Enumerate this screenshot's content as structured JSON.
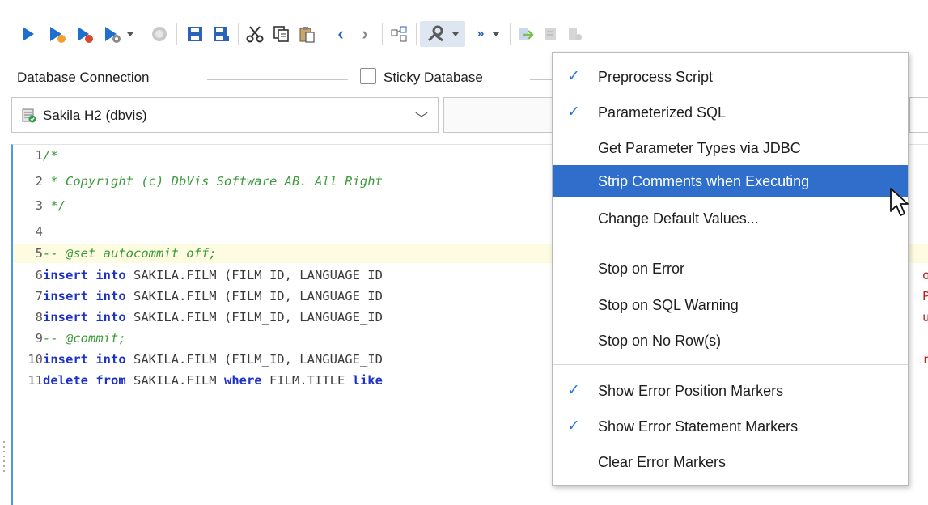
{
  "toolbar": {
    "buttons": [
      {
        "name": "execute-icon"
      },
      {
        "name": "execute-current-icon"
      },
      {
        "name": "execute-buffer-icon"
      },
      {
        "name": "execute-explain-icon"
      },
      {
        "name": "stop-icon"
      },
      {
        "name": "save-icon"
      },
      {
        "name": "save-as-icon"
      },
      {
        "name": "cut-icon"
      },
      {
        "name": "copy-icon"
      },
      {
        "name": "paste-icon"
      },
      {
        "name": "back-icon"
      },
      {
        "name": "forward-icon"
      },
      {
        "name": "query-builder-icon"
      },
      {
        "name": "sql-commander-options-icon"
      },
      {
        "name": "auto-commit-icon"
      },
      {
        "name": "commit-icon"
      },
      {
        "name": "rollback-icon"
      },
      {
        "name": "transaction-icon"
      }
    ]
  },
  "connection": {
    "label": "Database Connection",
    "sticky_label": "Sticky Database",
    "sticky_checked": false,
    "selected": "Sakila H2 (dbvis)"
  },
  "editor": {
    "lines": [
      {
        "no": "1",
        "text": "/*"
      },
      {
        "no": "2",
        "text": " * Copyright (c) DbVis Software AB. All Right"
      },
      {
        "no": "3",
        "text": " */"
      },
      {
        "no": "4",
        "text": ""
      },
      {
        "no": "5",
        "text": "-- @set autocommit off;"
      },
      {
        "no": "6",
        "kw": "insert into",
        "rest": " SAKILA.FILM (FILM_ID, LANGUAGE_ID"
      },
      {
        "no": "7",
        "kw": "insert into",
        "rest": " SAKILA.FILM (FILM_ID, LANGUAGE_ID"
      },
      {
        "no": "8",
        "kw": "insert into",
        "rest": " SAKILA.FILM (FILM_ID, LANGUAGE_ID"
      },
      {
        "no": "9",
        "text": "-- @commit;"
      },
      {
        "no": "10",
        "kw": "insert into",
        "rest": " SAKILA.FILM (FILM_ID, LANGUAGE_ID"
      },
      {
        "no": "11",
        "kw": "delete from",
        "rest": " SAKILA.FILM ",
        "kw2": "where",
        "rest2": " FILM.TITLE ",
        "kw3": "like"
      }
    ],
    "right_fragments": [
      "on",
      "P",
      "ua",
      "re"
    ]
  },
  "menu": {
    "items": [
      {
        "label": "Preprocess Script",
        "checked": true
      },
      {
        "label": "Parameterized SQL",
        "checked": true
      },
      {
        "label": "Get Parameter Types via JDBC",
        "checked": false
      },
      {
        "label": "Strip Comments when Executing",
        "checked": false,
        "highlighted": true
      },
      {
        "label": "Change Default Values...",
        "checked": false
      },
      {
        "label": "Stop on Error",
        "checked": false
      },
      {
        "label": "Stop on SQL Warning",
        "checked": false
      },
      {
        "label": "Stop on No Row(s)",
        "checked": false
      },
      {
        "label": "Show Error Position Markers",
        "checked": true
      },
      {
        "label": "Show Error Statement Markers",
        "checked": true
      },
      {
        "label": "Clear Error Markers",
        "checked": false
      }
    ],
    "check_glyph": "✓"
  },
  "colors": {
    "accent": "#1f6fd0",
    "menu_highlight": "#2f6fcb",
    "keyword": "#1e32c8",
    "comment": "#3a9b3a"
  }
}
